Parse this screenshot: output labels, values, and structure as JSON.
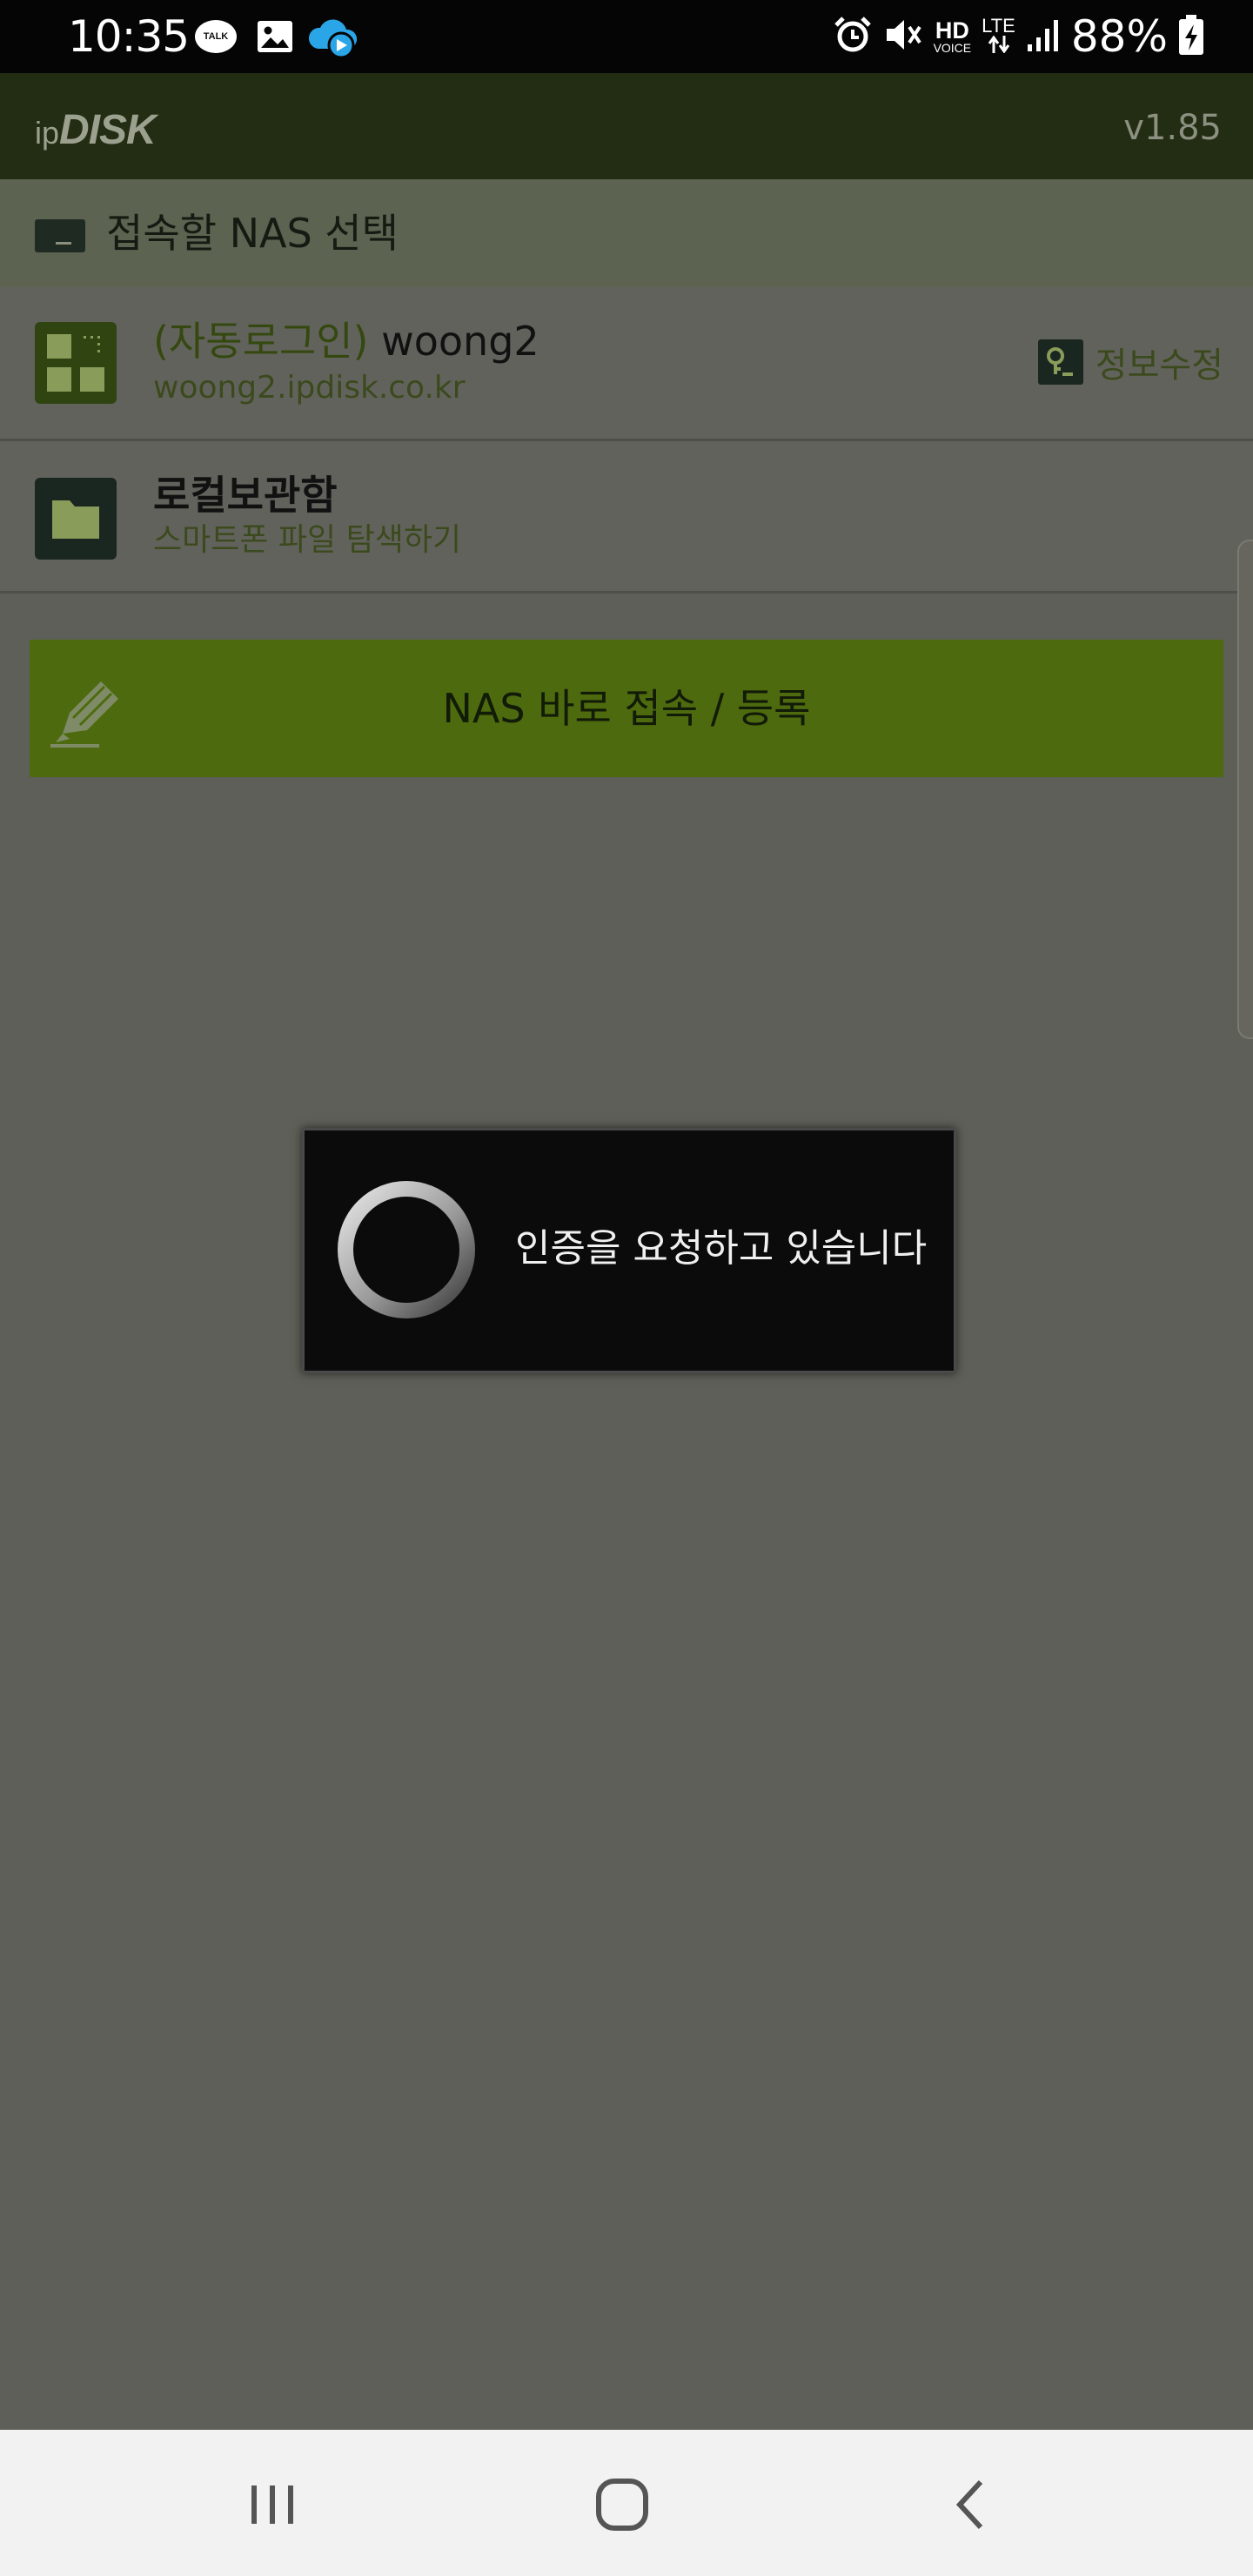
{
  "status_bar": {
    "time": "10:35",
    "talk_badge": "TALK",
    "hd": "HD",
    "hd_sub": "VOICE",
    "lte": "LTE",
    "battery": "88%",
    "icons": [
      "talk-icon",
      "gallery-icon",
      "cloud-upload-icon",
      "alarm-icon",
      "mute-icon",
      "signal-icon",
      "battery-charging-icon"
    ]
  },
  "app_bar": {
    "logo_prefix": "ip",
    "logo_main": "DISK",
    "version": "v1.85"
  },
  "section": {
    "title": "접속할 NAS 선택",
    "icon": "nas-icon"
  },
  "nas_list": [
    {
      "prefix": "(자동로그인)",
      "name": "woong2",
      "address": "woong2.ipdisk.co.kr",
      "icon": "grid-icon",
      "edit_label": "정보수정",
      "edit_icon": "key-icon"
    },
    {
      "name": "로컬보관함",
      "subtitle": "스마트폰 파일 탐색하기",
      "icon": "folder-icon"
    }
  ],
  "connect_button": {
    "label": "NAS 바로 접속 / 등록",
    "icon": "pencil-icon"
  },
  "dialog": {
    "message": "인증을 요청하고 있습니다"
  },
  "colors": {
    "app_bar": "#222d13",
    "accent": "#4d6b0e",
    "overlay": "#5e5f58",
    "dialog": "#0b0b0b"
  }
}
